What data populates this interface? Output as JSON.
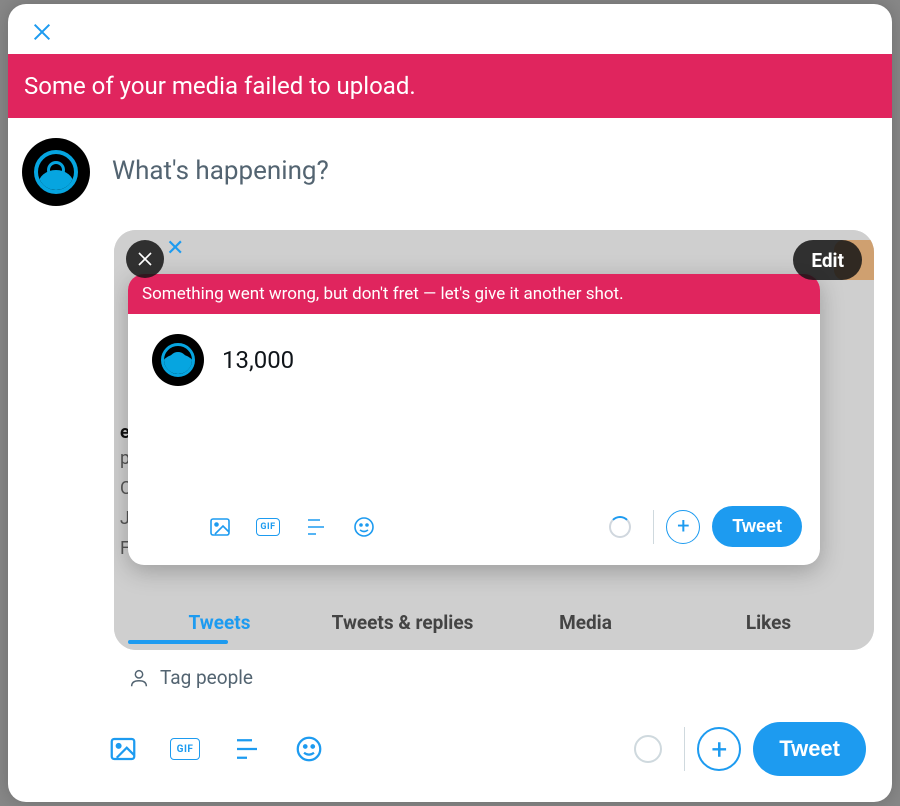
{
  "header": {
    "close_label": "Close"
  },
  "errors": {
    "outer": "Some of your media failed to upload.",
    "inner": "Something went wrong, but don't fret — let's give it another shot."
  },
  "compose": {
    "placeholder": "What's happening?"
  },
  "media": {
    "remove_label": "Remove",
    "edit_label": "Edit",
    "tag_people": "Tag people"
  },
  "inner_compose": {
    "text": "13,000"
  },
  "toolbar": {
    "image_label": "Add image",
    "gif_text": "GIF",
    "poll_label": "Add poll",
    "emoji_label": "Add emoji",
    "add_thread": "+",
    "tweet_label": "Tweet"
  },
  "bg_tabs": {
    "tweets": "Tweets",
    "replies": "Tweets & replies",
    "media": "Media",
    "likes": "Likes"
  },
  "bg_text": {
    "l1": "el",
    "l2": "po",
    "l3": "C",
    "l4": "Jo",
    "l5": "F"
  }
}
